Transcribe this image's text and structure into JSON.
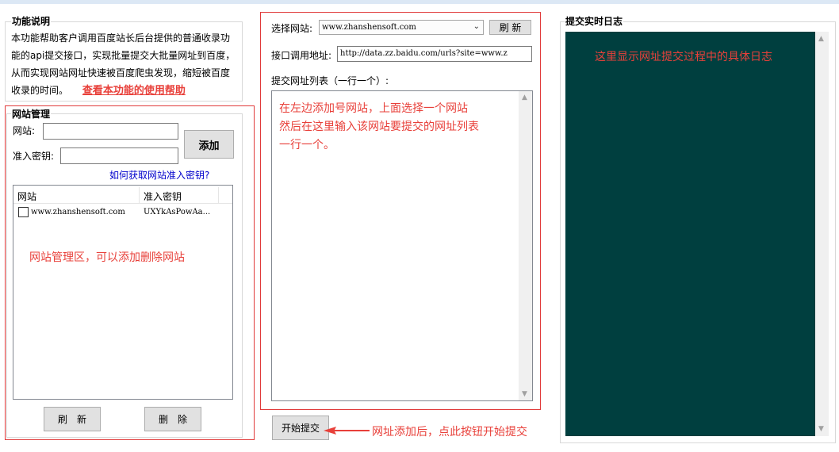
{
  "function_desc": {
    "title": "功能说明",
    "lines": [
      "本功能帮助客户调用百度站长后台提供的普通收录功",
      "能的api提交接口，实现批量提交大批量网址到百度，",
      "从而实现网站网址快速被百度爬虫发现，缩短被百度",
      "收录的时间。"
    ],
    "help_link": "查看本功能的使用帮助"
  },
  "site_mgmt": {
    "title": "网站管理",
    "site_label": "网站:",
    "site_value": "",
    "key_label": "准入密钥:",
    "key_value": "",
    "add_button": "添加",
    "get_key_link": "如何获取网站准入密钥?",
    "list_headers": [
      "网站",
      "准入密钥"
    ],
    "rows": [
      {
        "site": "www.zhanshensoft.com",
        "key": "UXYkAsPowAa..."
      }
    ],
    "annotation": "网站管理区，可以添加删除网站",
    "refresh_button": "刷　新",
    "delete_button": "删　除"
  },
  "submit_panel": {
    "select_label": "选择网站:",
    "selected_site": "www.zhanshensoft.com",
    "refresh_button": "刷 新",
    "api_label": "接口调用地址:",
    "api_value": "http://data.zz.baidu.com/urls?site=www.z",
    "list_label": "提交网址列表（一行一个）:",
    "annotation_lines": [
      "在左边添加号网站，上面选择一个网站",
      "然后在这里输入该网站要提交的网址列表",
      "一行一个。"
    ],
    "start_button": "开始提交",
    "start_annotation": "网址添加后，点此按钮开始提交"
  },
  "log_panel": {
    "title": "提交实时日志",
    "annotation": "这里显示网址提交过程中的具体日志"
  },
  "colors": {
    "accent_red": "#e8403a",
    "log_bg": "#003f3f",
    "link_blue": "#0000cc"
  }
}
